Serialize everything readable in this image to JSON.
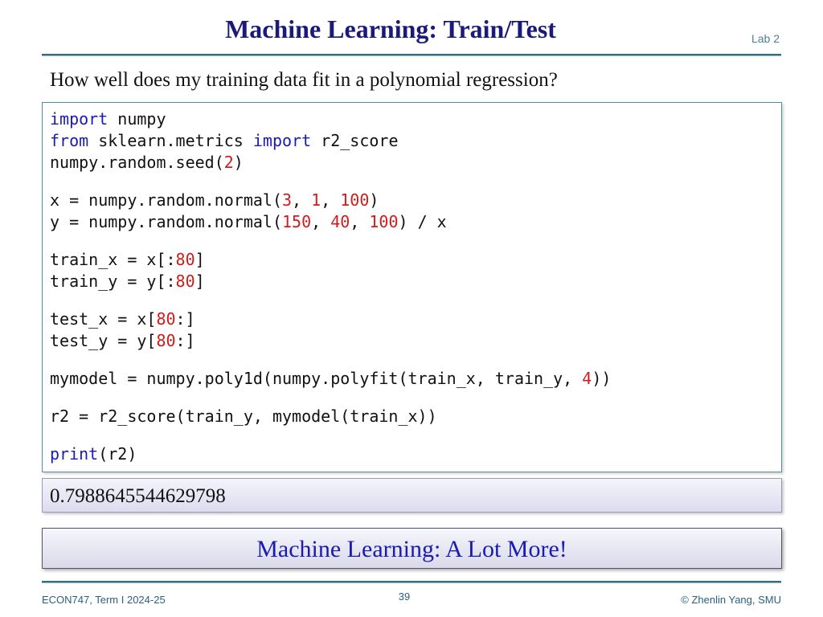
{
  "slide": {
    "title": "Machine Learning: Train/Test",
    "tag": "Lab 2",
    "question": "How well does my training data fit in a polynomial regression?",
    "output": "0.7988645544629798",
    "banner": "Machine Learning: A Lot More!"
  },
  "code": {
    "line1": {
      "kw": "import",
      "rest": " numpy"
    },
    "line2": {
      "kw1": "from",
      "mid": " sklearn.metrics ",
      "kw2": "import",
      "rest": " r2_score"
    },
    "line3": {
      "pre": "numpy.random.seed(",
      "n1": "2",
      "post": ")"
    },
    "line4": {
      "pre": "x = numpy.random.normal(",
      "n1": "3",
      "s1": ", ",
      "n2": "1",
      "s2": ", ",
      "n3": "100",
      "post": ")"
    },
    "line5": {
      "pre": "y = numpy.random.normal(",
      "n1": "150",
      "s1": ", ",
      "n2": "40",
      "s2": ", ",
      "n3": "100",
      "post": ") / x"
    },
    "line6": {
      "pre": "train_x = x[:",
      "n1": "80",
      "post": "]"
    },
    "line7": {
      "pre": "train_y = y[:",
      "n1": "80",
      "post": "]"
    },
    "line8": {
      "pre": "test_x = x[",
      "n1": "80",
      "post": ":]"
    },
    "line9": {
      "pre": "test_y = y[",
      "n1": "80",
      "post": ":]"
    },
    "line10": {
      "pre": "mymodel = numpy.poly1d(numpy.polyfit(train_x, train_y, ",
      "n1": "4",
      "post": "))"
    },
    "line11": {
      "text": "r2 = r2_score(train_y, mymodel(train_x))"
    },
    "line12": {
      "kw": "print",
      "rest": "(r2)"
    }
  },
  "footer": {
    "course": "ECON747, Term I  2024-25",
    "page": "39",
    "copyright": "© Zhenlin Yang, SMU"
  },
  "colors": {
    "title": "#1a1a7a",
    "keyword": "#1a1ab4",
    "number": "#d01c1c",
    "rule": "#2f6f80"
  }
}
